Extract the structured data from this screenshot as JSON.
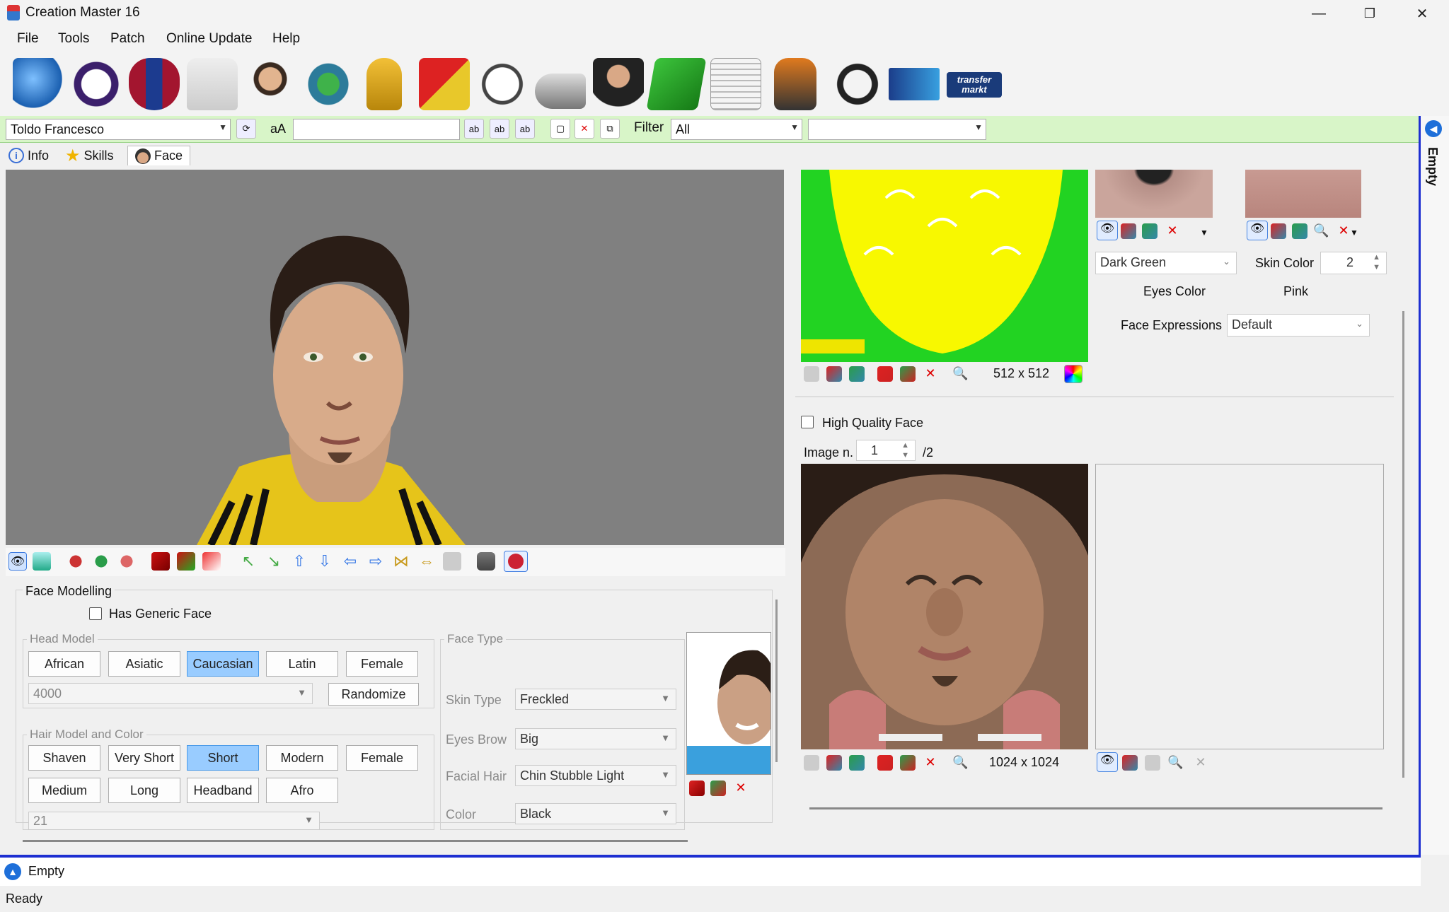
{
  "window": {
    "title": "Creation Master 16",
    "minimize": "—",
    "maximize": "❐",
    "close": "✕"
  },
  "menu": [
    "File",
    "Tools",
    "Patch",
    "Online Update",
    "Help"
  ],
  "player_selector": {
    "value": "Toldo Francesco",
    "case_button": "aA"
  },
  "filter": {
    "label": "Filter",
    "value": "All",
    "secondary_value": ""
  },
  "tabs": [
    "Info",
    "Skills",
    "Face"
  ],
  "face_modelling": {
    "title": "Face Modelling",
    "has_generic_face_label": "Has Generic Face",
    "head_model": {
      "label": "Head Model",
      "options": [
        "African",
        "Asiatic",
        "Caucasian",
        "Latin",
        "Female"
      ],
      "selected": "Caucasian",
      "model_id": "4000",
      "randomize_label": "Randomize"
    },
    "hair": {
      "label": "Hair Model and Color",
      "row1": [
        "Shaven",
        "Very Short",
        "Short",
        "Modern",
        "Female"
      ],
      "row2": [
        "Medium",
        "Long",
        "Headband",
        "Afro"
      ],
      "selected": "Short",
      "model_id": "21"
    },
    "face_type": {
      "label": "Face Type",
      "fields": [
        {
          "label": "Skin Type",
          "value": "Freckled"
        },
        {
          "label": "Eyes Brow",
          "value": "Big"
        },
        {
          "label": "Facial Hair",
          "value": "Chin Stubble Light"
        },
        {
          "label": "Color",
          "value": "Black"
        }
      ]
    }
  },
  "texture_panel": {
    "texture_size": "512 x 512",
    "eyes_color_value": "Dark Green",
    "eyes_color_label": "Eyes Color",
    "skin_color_label": "Skin Color",
    "skin_color_value": "2",
    "skin_color_name": "Pink",
    "face_expressions_label": "Face Expressions",
    "face_expressions_value": "Default"
  },
  "hq_panel": {
    "high_quality_label": "High Quality Face",
    "image_n_label": "Image n.",
    "image_n_value": "1",
    "image_n_total": "/2",
    "face_texture_size": "1024 x 1024"
  },
  "right_strip_label": "Empty",
  "bottom_strip_label": "Empty",
  "status": "Ready",
  "colors": {
    "accent_blue": "#1d2fd1",
    "selected_button": "#99ccff",
    "player_bar": "#d8f5c8"
  }
}
